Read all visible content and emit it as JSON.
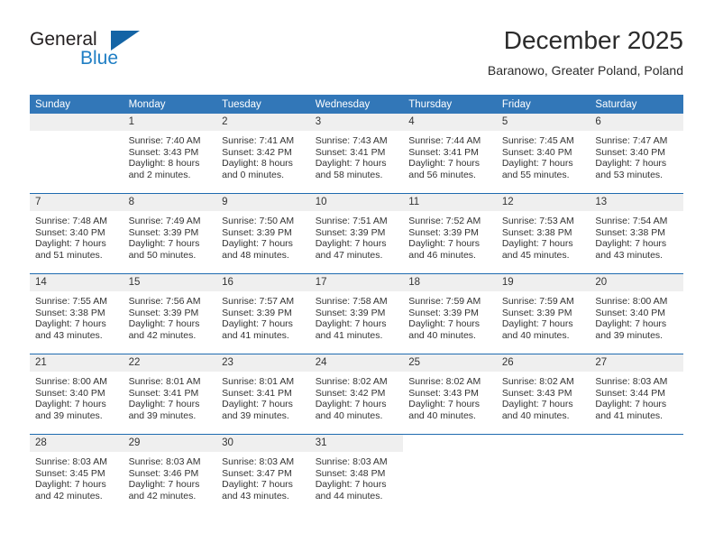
{
  "brand": {
    "word_general": "General",
    "word_blue": "Blue",
    "triangle_color": "#1464a5",
    "blue_text_color": "#1f7ec4"
  },
  "header": {
    "title": "December 2025",
    "subtitle": "Baranowo, Greater Poland, Poland",
    "header_bg": "#3277b8",
    "row_divider": "#1f6bb0",
    "daynum_bg": "#efefef"
  },
  "weekday_headers": [
    "Sunday",
    "Monday",
    "Tuesday",
    "Wednesday",
    "Thursday",
    "Friday",
    "Saturday"
  ],
  "weeks": [
    [
      {
        "day": "",
        "sunrise": "",
        "sunset": "",
        "daylight_line1": "",
        "daylight_line2": ""
      },
      {
        "day": "1",
        "sunrise": "Sunrise: 7:40 AM",
        "sunset": "Sunset: 3:43 PM",
        "daylight_line1": "Daylight: 8 hours",
        "daylight_line2": "and 2 minutes."
      },
      {
        "day": "2",
        "sunrise": "Sunrise: 7:41 AM",
        "sunset": "Sunset: 3:42 PM",
        "daylight_line1": "Daylight: 8 hours",
        "daylight_line2": "and 0 minutes."
      },
      {
        "day": "3",
        "sunrise": "Sunrise: 7:43 AM",
        "sunset": "Sunset: 3:41 PM",
        "daylight_line1": "Daylight: 7 hours",
        "daylight_line2": "and 58 minutes."
      },
      {
        "day": "4",
        "sunrise": "Sunrise: 7:44 AM",
        "sunset": "Sunset: 3:41 PM",
        "daylight_line1": "Daylight: 7 hours",
        "daylight_line2": "and 56 minutes."
      },
      {
        "day": "5",
        "sunrise": "Sunrise: 7:45 AM",
        "sunset": "Sunset: 3:40 PM",
        "daylight_line1": "Daylight: 7 hours",
        "daylight_line2": "and 55 minutes."
      },
      {
        "day": "6",
        "sunrise": "Sunrise: 7:47 AM",
        "sunset": "Sunset: 3:40 PM",
        "daylight_line1": "Daylight: 7 hours",
        "daylight_line2": "and 53 minutes."
      }
    ],
    [
      {
        "day": "7",
        "sunrise": "Sunrise: 7:48 AM",
        "sunset": "Sunset: 3:40 PM",
        "daylight_line1": "Daylight: 7 hours",
        "daylight_line2": "and 51 minutes."
      },
      {
        "day": "8",
        "sunrise": "Sunrise: 7:49 AM",
        "sunset": "Sunset: 3:39 PM",
        "daylight_line1": "Daylight: 7 hours",
        "daylight_line2": "and 50 minutes."
      },
      {
        "day": "9",
        "sunrise": "Sunrise: 7:50 AM",
        "sunset": "Sunset: 3:39 PM",
        "daylight_line1": "Daylight: 7 hours",
        "daylight_line2": "and 48 minutes."
      },
      {
        "day": "10",
        "sunrise": "Sunrise: 7:51 AM",
        "sunset": "Sunset: 3:39 PM",
        "daylight_line1": "Daylight: 7 hours",
        "daylight_line2": "and 47 minutes."
      },
      {
        "day": "11",
        "sunrise": "Sunrise: 7:52 AM",
        "sunset": "Sunset: 3:39 PM",
        "daylight_line1": "Daylight: 7 hours",
        "daylight_line2": "and 46 minutes."
      },
      {
        "day": "12",
        "sunrise": "Sunrise: 7:53 AM",
        "sunset": "Sunset: 3:38 PM",
        "daylight_line1": "Daylight: 7 hours",
        "daylight_line2": "and 45 minutes."
      },
      {
        "day": "13",
        "sunrise": "Sunrise: 7:54 AM",
        "sunset": "Sunset: 3:38 PM",
        "daylight_line1": "Daylight: 7 hours",
        "daylight_line2": "and 43 minutes."
      }
    ],
    [
      {
        "day": "14",
        "sunrise": "Sunrise: 7:55 AM",
        "sunset": "Sunset: 3:38 PM",
        "daylight_line1": "Daylight: 7 hours",
        "daylight_line2": "and 43 minutes."
      },
      {
        "day": "15",
        "sunrise": "Sunrise: 7:56 AM",
        "sunset": "Sunset: 3:39 PM",
        "daylight_line1": "Daylight: 7 hours",
        "daylight_line2": "and 42 minutes."
      },
      {
        "day": "16",
        "sunrise": "Sunrise: 7:57 AM",
        "sunset": "Sunset: 3:39 PM",
        "daylight_line1": "Daylight: 7 hours",
        "daylight_line2": "and 41 minutes."
      },
      {
        "day": "17",
        "sunrise": "Sunrise: 7:58 AM",
        "sunset": "Sunset: 3:39 PM",
        "daylight_line1": "Daylight: 7 hours",
        "daylight_line2": "and 41 minutes."
      },
      {
        "day": "18",
        "sunrise": "Sunrise: 7:59 AM",
        "sunset": "Sunset: 3:39 PM",
        "daylight_line1": "Daylight: 7 hours",
        "daylight_line2": "and 40 minutes."
      },
      {
        "day": "19",
        "sunrise": "Sunrise: 7:59 AM",
        "sunset": "Sunset: 3:39 PM",
        "daylight_line1": "Daylight: 7 hours",
        "daylight_line2": "and 40 minutes."
      },
      {
        "day": "20",
        "sunrise": "Sunrise: 8:00 AM",
        "sunset": "Sunset: 3:40 PM",
        "daylight_line1": "Daylight: 7 hours",
        "daylight_line2": "and 39 minutes."
      }
    ],
    [
      {
        "day": "21",
        "sunrise": "Sunrise: 8:00 AM",
        "sunset": "Sunset: 3:40 PM",
        "daylight_line1": "Daylight: 7 hours",
        "daylight_line2": "and 39 minutes."
      },
      {
        "day": "22",
        "sunrise": "Sunrise: 8:01 AM",
        "sunset": "Sunset: 3:41 PM",
        "daylight_line1": "Daylight: 7 hours",
        "daylight_line2": "and 39 minutes."
      },
      {
        "day": "23",
        "sunrise": "Sunrise: 8:01 AM",
        "sunset": "Sunset: 3:41 PM",
        "daylight_line1": "Daylight: 7 hours",
        "daylight_line2": "and 39 minutes."
      },
      {
        "day": "24",
        "sunrise": "Sunrise: 8:02 AM",
        "sunset": "Sunset: 3:42 PM",
        "daylight_line1": "Daylight: 7 hours",
        "daylight_line2": "and 40 minutes."
      },
      {
        "day": "25",
        "sunrise": "Sunrise: 8:02 AM",
        "sunset": "Sunset: 3:43 PM",
        "daylight_line1": "Daylight: 7 hours",
        "daylight_line2": "and 40 minutes."
      },
      {
        "day": "26",
        "sunrise": "Sunrise: 8:02 AM",
        "sunset": "Sunset: 3:43 PM",
        "daylight_line1": "Daylight: 7 hours",
        "daylight_line2": "and 40 minutes."
      },
      {
        "day": "27",
        "sunrise": "Sunrise: 8:03 AM",
        "sunset": "Sunset: 3:44 PM",
        "daylight_line1": "Daylight: 7 hours",
        "daylight_line2": "and 41 minutes."
      }
    ],
    [
      {
        "day": "28",
        "sunrise": "Sunrise: 8:03 AM",
        "sunset": "Sunset: 3:45 PM",
        "daylight_line1": "Daylight: 7 hours",
        "daylight_line2": "and 42 minutes."
      },
      {
        "day": "29",
        "sunrise": "Sunrise: 8:03 AM",
        "sunset": "Sunset: 3:46 PM",
        "daylight_line1": "Daylight: 7 hours",
        "daylight_line2": "and 42 minutes."
      },
      {
        "day": "30",
        "sunrise": "Sunrise: 8:03 AM",
        "sunset": "Sunset: 3:47 PM",
        "daylight_line1": "Daylight: 7 hours",
        "daylight_line2": "and 43 minutes."
      },
      {
        "day": "31",
        "sunrise": "Sunrise: 8:03 AM",
        "sunset": "Sunset: 3:48 PM",
        "daylight_line1": "Daylight: 7 hours",
        "daylight_line2": "and 44 minutes."
      },
      {
        "day": "",
        "sunrise": "",
        "sunset": "",
        "daylight_line1": "",
        "daylight_line2": ""
      },
      {
        "day": "",
        "sunrise": "",
        "sunset": "",
        "daylight_line1": "",
        "daylight_line2": ""
      },
      {
        "day": "",
        "sunrise": "",
        "sunset": "",
        "daylight_line1": "",
        "daylight_line2": ""
      }
    ]
  ]
}
